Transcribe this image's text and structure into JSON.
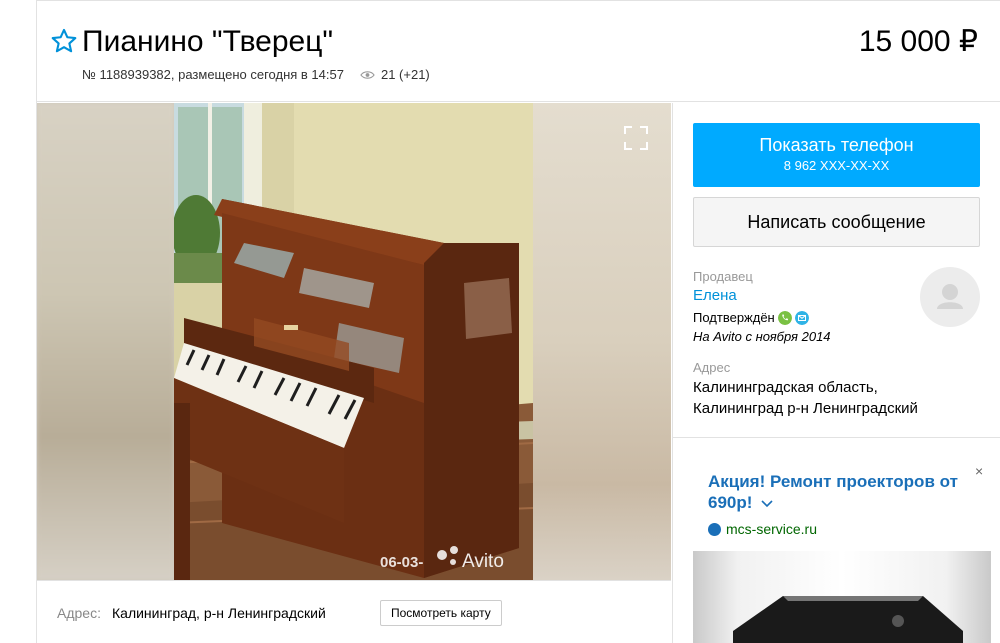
{
  "listing": {
    "title": "Пианино \"Тверец\"",
    "price": "15 000 ₽",
    "meta": "№ 1188939382, размещено сегодня в 14:57",
    "views": "21 (+21)"
  },
  "gallery": {
    "watermark_date": "06-03-",
    "watermark_brand": "Avito"
  },
  "location": {
    "label": "Адрес:",
    "value": "Калининград, р-н Ленинградский",
    "map_button": "Посмотреть карту"
  },
  "contact": {
    "phone_button": "Показать телефон",
    "phone_number": "8 962 XXX-XX-XX",
    "message_button": "Написать сообщение"
  },
  "seller": {
    "label": "Продавец",
    "name": "Елена",
    "verified": "Подтверждён",
    "since": "На Avito с ноября 2014",
    "address_label": "Адрес",
    "address_line1": "Калининградская область,",
    "address_line2": "Калининград р-н Ленинградский"
  },
  "ad": {
    "close": "×",
    "title": "Акция! Ремонт проекторов от 690р!",
    "site": "mcs-service.ru"
  },
  "colors": {
    "accent": "#00aaff",
    "link": "#0091d9",
    "ad_title": "#1a6fb8",
    "ad_site": "#006600"
  },
  "icons": [
    "star-icon",
    "eye-icon",
    "expand-icon",
    "phone-verified-icon",
    "email-verified-icon",
    "avatar-placeholder-icon",
    "chevron-down-icon"
  ]
}
